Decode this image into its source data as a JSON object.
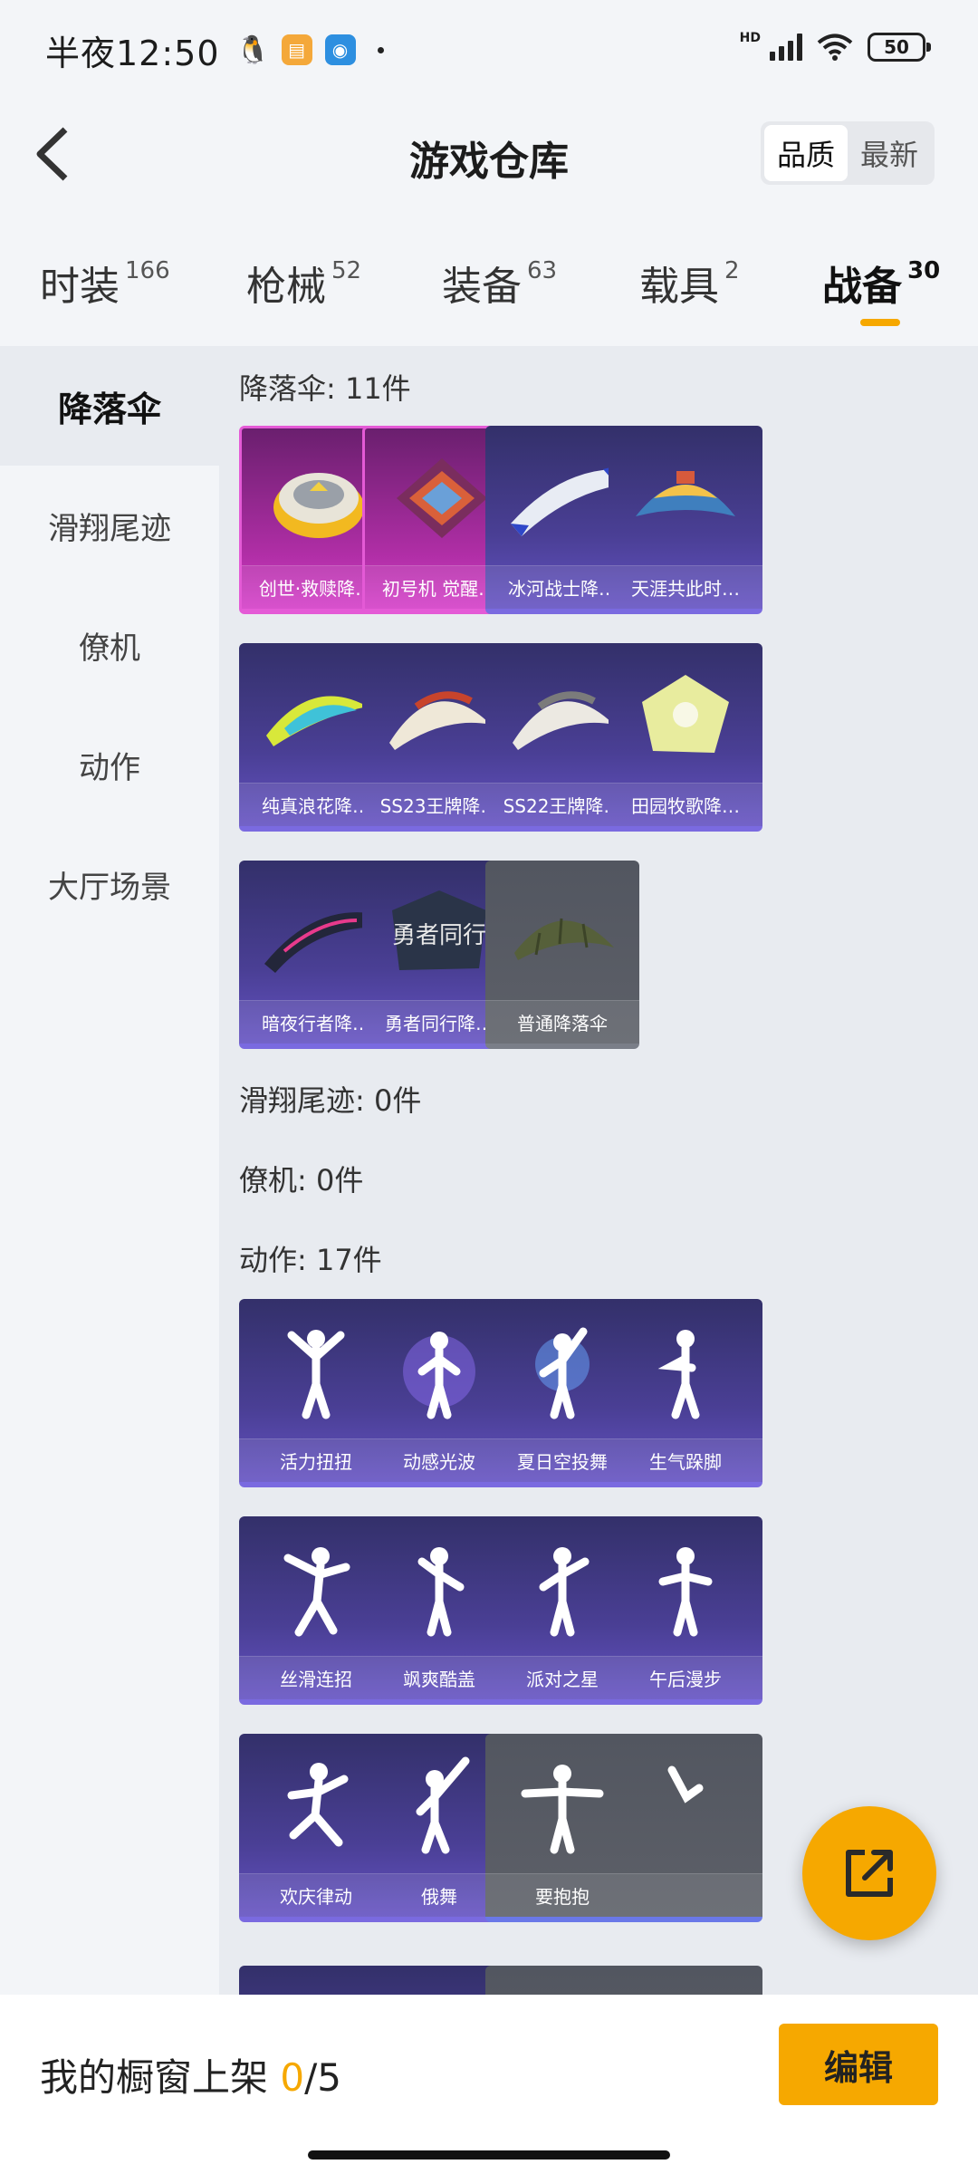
{
  "status": {
    "time": "半夜12:50",
    "battery": "50",
    "hd": "HD"
  },
  "header": {
    "title": "游戏仓库",
    "sort_quality": "品质",
    "sort_latest": "最新"
  },
  "tabs": [
    {
      "label": "时装",
      "count": "166"
    },
    {
      "label": "枪械",
      "count": "52"
    },
    {
      "label": "装备",
      "count": "63"
    },
    {
      "label": "载具",
      "count": "2"
    },
    {
      "label": "战备",
      "count": "30"
    }
  ],
  "sidebar": {
    "items": [
      "降落伞",
      "滑翔尾迹",
      "僚机",
      "动作",
      "大厅场景"
    ]
  },
  "sections": {
    "parachute": "降落伞: 11件",
    "glide": "滑翔尾迹: 0件",
    "wingman": "僚机: 0件",
    "emote": "动作: 17件"
  },
  "parachutes": [
    "创世·救赎降…",
    "初号机 觉醒…",
    "冰河战士降…",
    "天涯共此时…",
    "纯真浪花降…",
    "SS23王牌降…",
    "SS22王牌降…",
    "田园牧歌降…",
    "暗夜行者降…",
    "勇者同行降…",
    "普通降落伞"
  ],
  "parachute_art": {
    "p9": "勇者同行"
  },
  "emotes": [
    "活力扭扭",
    "动感光波",
    "夏日空投舞",
    "生气跺脚",
    "丝滑连招",
    "飒爽酷盖",
    "派对之星",
    "午后漫步",
    "欢庆律动",
    "俄舞",
    "要抱抱",
    ""
  ],
  "bottom": {
    "shelf_prefix": "我的橱窗上架 ",
    "shelf_count": "0",
    "shelf_total": "/5",
    "edit": "编辑"
  },
  "colors": {
    "accent": "#f6a800",
    "card_purple": "#4a3f95",
    "card_pink": "#b02ea6",
    "card_gray": "#5d6068"
  }
}
